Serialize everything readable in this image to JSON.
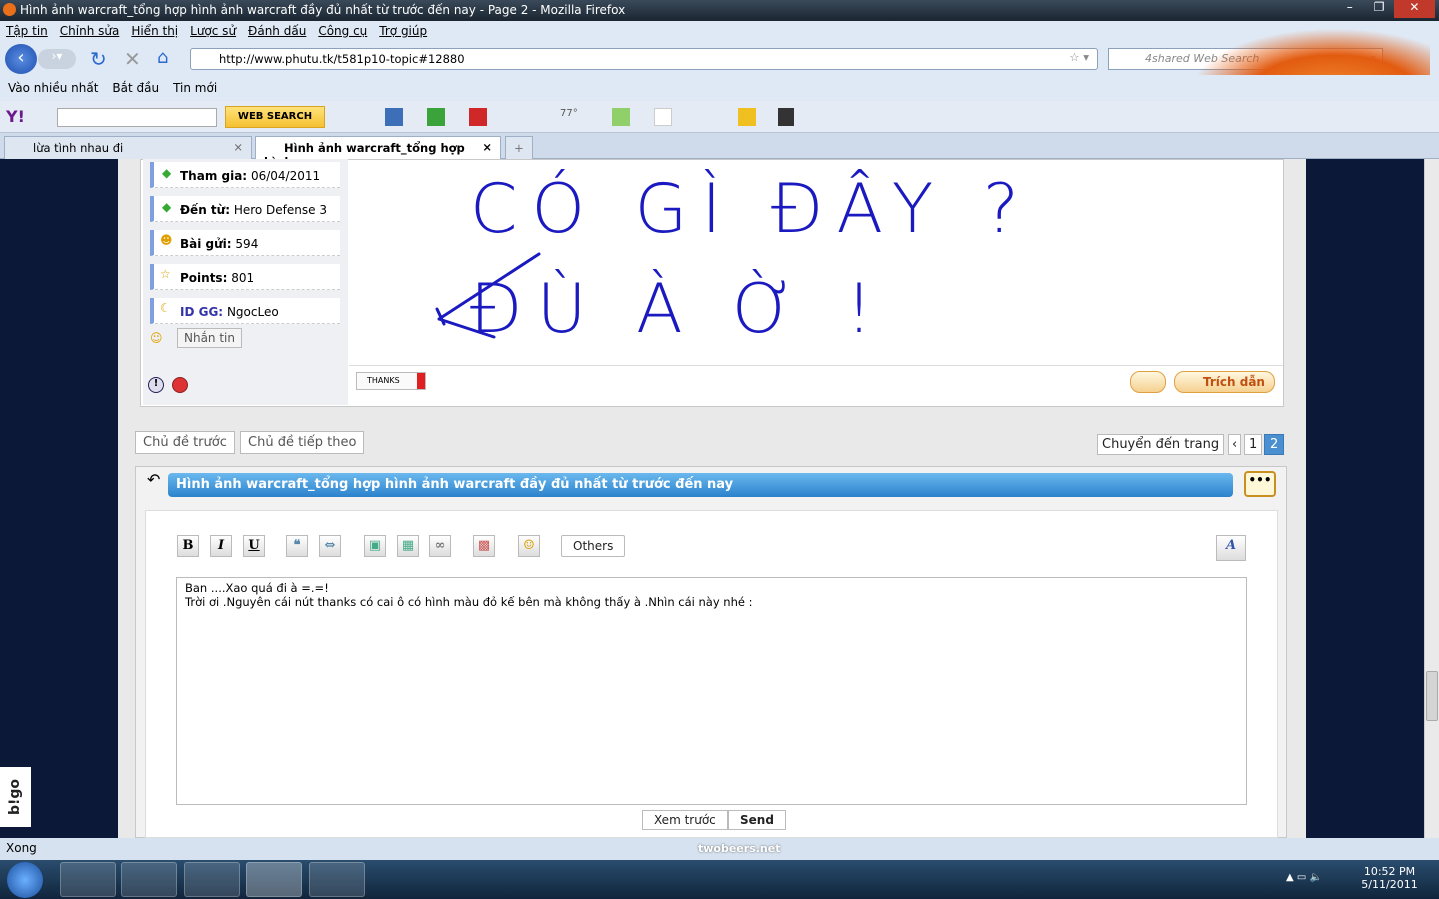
{
  "window": {
    "title": "Hình ảnh warcraft_tổng hợp hình ảnh warcraft đầy đủ nhất từ trước đến nay - Page 2 - Mozilla Firefox"
  },
  "menu": [
    "Tập tin",
    "Chỉnh sửa",
    "Hiển thị",
    "Lược sử",
    "Đánh dấu",
    "Công cụ",
    "Trợ giúp"
  ],
  "url": "http://www.phutu.tk/t581p10-topic#12880",
  "search_placeholder": "4shared Web Search",
  "bookmarks": [
    "Vào nhiều nhất",
    "Bắt đầu",
    "Tin mới"
  ],
  "yahoo": {
    "logo": "Y!",
    "search_button": "WEB SEARCH",
    "weather": "77°"
  },
  "tabs": [
    {
      "label": "lừa tình nhau đi"
    },
    {
      "label": "Hình ảnh warcraft_tổng hợp hình ...",
      "active": true
    }
  ],
  "profile": {
    "joined_label": "Tham gia:",
    "joined": "06/04/2011",
    "from_label": "Đến từ:",
    "from": "Hero Defense 3",
    "posts_label": "Bài gửi:",
    "posts": "594",
    "points_label": "Points:",
    "points": "801",
    "id_label": "ID GG:",
    "id": "NgocLeo",
    "message_button": "Nhắn tin"
  },
  "post": {
    "drawing_text": "CÓ GÌ ĐÂY ? ĐÙ À Ờ !",
    "thanks": "THANKS",
    "quote": "Trích dẫn"
  },
  "nav": {
    "prev_topic": "Chủ đề trước",
    "next_topic": "Chủ đề tiếp theo",
    "goto_page": "Chuyển đến trang",
    "prev": "‹",
    "pages": [
      "1",
      "2"
    ],
    "current_page": "2"
  },
  "reply": {
    "title": "Hình ảnh warcraft_tổng hợp hình ảnh warcraft đầy đủ nhất từ trước đến nay",
    "toolbar": [
      "B",
      "I",
      "U"
    ],
    "others": "Others",
    "text_line1": "Ban ....Xao quá đi à =.=!",
    "text_line2": "Trời ơi .Nguyên cái nút thanks có cai ô có hình màu đỏ kế bên mà không thấy à .Nhìn cái này nhé :",
    "preview": "Xem trước",
    "send": "Send"
  },
  "status": "Xong",
  "status_center": "twobeers.net",
  "side_widget": "b!go",
  "clock": {
    "time": "10:52 PM",
    "date": "5/11/2011"
  }
}
